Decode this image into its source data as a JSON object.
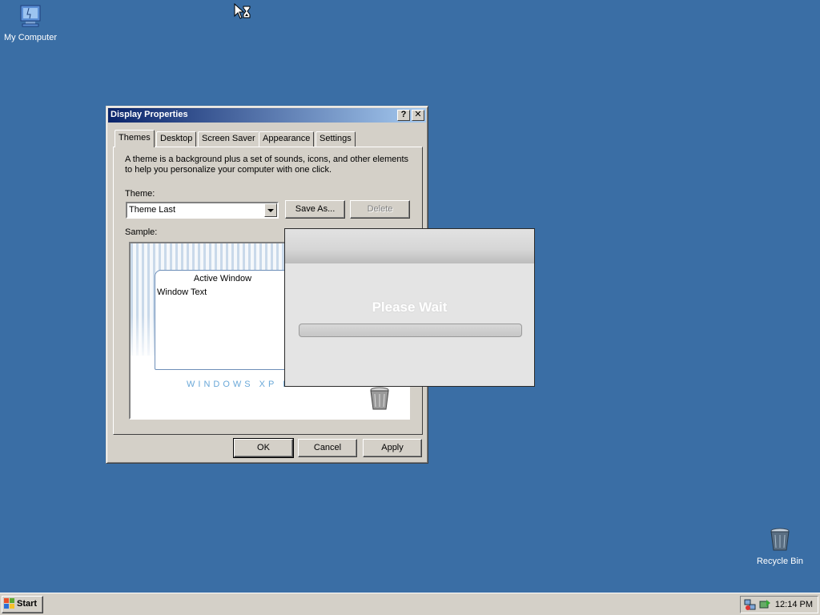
{
  "desktop": {
    "icons": [
      {
        "label": "My Computer",
        "icon": "my-computer-icon"
      },
      {
        "label": "Recycle Bin",
        "icon": "recycle-bin-icon"
      }
    ],
    "background_color": "#3a6ea5"
  },
  "dialog": {
    "title": "Display Properties",
    "title_buttons": {
      "help": "?",
      "close": "✕"
    },
    "tabs": [
      {
        "label": "Themes",
        "active": true
      },
      {
        "label": "Desktop",
        "active": false
      },
      {
        "label": "Screen Saver",
        "active": false
      },
      {
        "label": "Appearance",
        "active": false
      },
      {
        "label": "Settings",
        "active": false
      }
    ],
    "description": "A theme is a background plus a set of sounds, icons, and other elements to help you personalize your computer with one click.",
    "theme_label": "Theme:",
    "theme_value": "Theme Last",
    "save_as_label": "Save As...",
    "delete_label": "Delete",
    "sample_label": "Sample:",
    "sample": {
      "window_title": "Active Window",
      "window_text": "Window Text",
      "brand_text": "WINDOWS XP M"
    },
    "buttons": {
      "ok": "OK",
      "cancel": "Cancel",
      "apply": "Apply"
    }
  },
  "wait_popup": {
    "title": "Please Wait",
    "progress": 0
  },
  "taskbar": {
    "start_label": "Start",
    "tray_icons": [
      "network-icon",
      "safely-remove-icon"
    ],
    "clock": "12:14 PM"
  }
}
